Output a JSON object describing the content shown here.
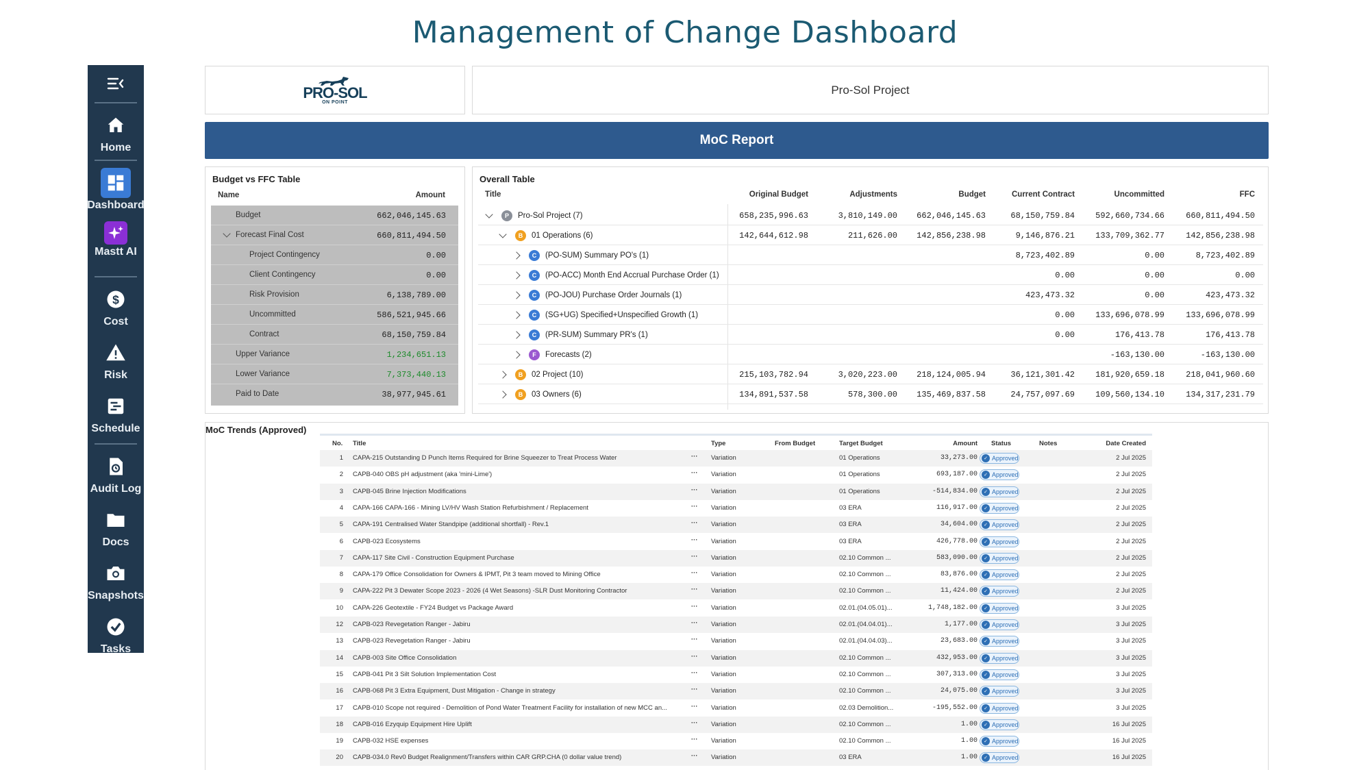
{
  "page": {
    "title": "Management of Change Dashboard"
  },
  "sidebar": {
    "items": [
      {
        "label": "Home",
        "icon": "home-icon"
      },
      {
        "label": "Dashboard",
        "icon": "dashboard-icon",
        "active": true
      },
      {
        "label": "Mastt AI",
        "icon": "sparkle-icon"
      },
      {
        "label": "Cost",
        "icon": "dollar-icon"
      },
      {
        "label": "Risk",
        "icon": "warning-icon"
      },
      {
        "label": "Schedule",
        "icon": "schedule-icon"
      },
      {
        "label": "Audit Log",
        "icon": "history-icon"
      },
      {
        "label": "Docs",
        "icon": "folder-icon"
      },
      {
        "label": "Snapshots",
        "icon": "camera-icon"
      },
      {
        "label": "Tasks",
        "icon": "check-circle-icon"
      }
    ]
  },
  "header": {
    "logo_text": "PRO-SOL",
    "logo_sub": "ON POINT",
    "project_name": "Pro-Sol Project",
    "report_title": "MoC Report"
  },
  "colors": {
    "sidebar": "#21384e",
    "banner": "#2e5a8e",
    "title": "#1b5a72",
    "positive": "#1c8a2a"
  },
  "budget_vs_ffc": {
    "title": "Budget vs FFC Table",
    "col_name": "Name",
    "col_amount": "Amount",
    "rows": [
      {
        "name": "Budget",
        "amount": "662,046,145.63"
      },
      {
        "name": "Forecast Final Cost",
        "amount": "660,811,494.50"
      },
      {
        "name": "Project Contingency",
        "amount": "0.00"
      },
      {
        "name": "Client Contingency",
        "amount": "0.00"
      },
      {
        "name": "Risk Provision",
        "amount": "6,138,789.00"
      },
      {
        "name": "Uncommitted",
        "amount": "586,521,945.66"
      },
      {
        "name": "Contract",
        "amount": "68,150,759.84"
      },
      {
        "name": "Upper Variance",
        "amount": "1,234,651.13"
      },
      {
        "name": "Lower Variance",
        "amount": "7,373,440.13"
      },
      {
        "name": "Paid to Date",
        "amount": "38,977,945.61"
      }
    ]
  },
  "overall": {
    "title": "Overall Table",
    "columns": [
      "Title",
      "Original Budget",
      "Adjustments",
      "Budget",
      "Current Contract",
      "Uncommitted",
      "FFC"
    ],
    "rows": [
      {
        "title": "Pro-Sol Project  (7)",
        "badge": "P",
        "ob": "658,235,996.63",
        "adj": "3,810,149.00",
        "bud": "662,046,145.63",
        "cc": "68,150,759.84",
        "unc": "592,660,734.66",
        "ffc": "660,811,494.50"
      },
      {
        "title": "01 Operations  (6)",
        "badge": "B",
        "ob": "142,644,612.98",
        "adj": "211,626.00",
        "bud": "142,856,238.98",
        "cc": "9,146,876.21",
        "unc": "133,709,362.77",
        "ffc": "142,856,238.98"
      },
      {
        "title": "(PO-SUM) Summary PO's  (1)",
        "badge": "C",
        "ob": "",
        "adj": "",
        "bud": "",
        "cc": "8,723,402.89",
        "unc": "0.00",
        "ffc": "8,723,402.89"
      },
      {
        "title": "(PO-ACC) Month End Accrual Purchase Order  (1)",
        "badge": "C",
        "ob": "",
        "adj": "",
        "bud": "",
        "cc": "0.00",
        "unc": "0.00",
        "ffc": "0.00"
      },
      {
        "title": "(PO-JOU) Purchase Order Journals  (1)",
        "badge": "C",
        "ob": "",
        "adj": "",
        "bud": "",
        "cc": "423,473.32",
        "unc": "0.00",
        "ffc": "423,473.32"
      },
      {
        "title": "(SG+UG) Specified+Unspecified Growth  (1)",
        "badge": "C",
        "ob": "",
        "adj": "",
        "bud": "",
        "cc": "0.00",
        "unc": "133,696,078.99",
        "ffc": "133,696,078.99"
      },
      {
        "title": "(PR-SUM) Summary PR's  (1)",
        "badge": "C",
        "ob": "",
        "adj": "",
        "bud": "",
        "cc": "0.00",
        "unc": "176,413.78",
        "ffc": "176,413.78"
      },
      {
        "title": "Forecasts  (2)",
        "badge": "F",
        "ob": "",
        "adj": "",
        "bud": "",
        "cc": "",
        "unc": "-163,130.00",
        "ffc": "-163,130.00"
      },
      {
        "title": "02 Project  (10)",
        "badge": "B",
        "ob": "215,103,782.94",
        "adj": "3,020,223.00",
        "bud": "218,124,005.94",
        "cc": "36,121,301.42",
        "unc": "181,920,659.18",
        "ffc": "218,041,960.60"
      },
      {
        "title": "03 Owners  (6)",
        "badge": "B",
        "ob": "134,891,537.58",
        "adj": "578,300.00",
        "bud": "135,469,837.58",
        "cc": "24,757,097.69",
        "unc": "109,560,134.10",
        "ffc": "134,317,231.79"
      }
    ]
  },
  "trends": {
    "title": "MoC Trends (Approved)",
    "columns": [
      "No.",
      "Title",
      "Type",
      "From Budget",
      "Target Budget",
      "Amount",
      "Status",
      "Notes",
      "Date Created"
    ],
    "more_label": "···",
    "status_label": "Approved",
    "rows": [
      {
        "no": "1",
        "title": "CAPA-215 Outstanding D Punch Items Required for Brine Squeezer to Treat Process Water",
        "type": "Variation",
        "target": "01 Operations",
        "amount": "33,273.00",
        "date": "2 Jul 2025"
      },
      {
        "no": "2",
        "title": "CAPB-040 OBS pH adjustment (aka 'mini-Lime')",
        "type": "Variation",
        "target": "01 Operations",
        "amount": "693,187.00",
        "date": "2 Jul 2025"
      },
      {
        "no": "3",
        "title": "CAPB-045 Brine Injection Modifications",
        "type": "Variation",
        "target": "01 Operations",
        "amount": "-514,834.00",
        "date": "2 Jul 2025"
      },
      {
        "no": "4",
        "title": "CAPA-166 CAPA-166 - Mining LV/HV Wash Station Refurbishment / Replacement",
        "type": "Variation",
        "target": "03 ERA",
        "amount": "116,917.00",
        "date": "2 Jul 2025"
      },
      {
        "no": "5",
        "title": "CAPA-191 Centralised Water Standpipe (additional shortfall) - Rev.1",
        "type": "Variation",
        "target": "03 ERA",
        "amount": "34,604.00",
        "date": "2 Jul 2025"
      },
      {
        "no": "6",
        "title": "CAPB-023 Ecosystems",
        "type": "Variation",
        "target": "03 ERA",
        "amount": "426,778.00",
        "date": "2 Jul 2025"
      },
      {
        "no": "7",
        "title": "CAPA-117 Site Civil - Construction Equipment Purchase",
        "type": "Variation",
        "target": "02.10 Common ...",
        "amount": "583,090.00",
        "date": "2 Jul 2025"
      },
      {
        "no": "8",
        "title": "CAPA-179 Office Consolidation for Owners & IPMT, Pit 3 team moved to Mining Office",
        "type": "Variation",
        "target": "02.10 Common ...",
        "amount": "83,876.00",
        "date": "2 Jul 2025"
      },
      {
        "no": "9",
        "title": "CAPA-222 Pit 3 Dewater Scope 2023 - 2026 (4 Wet Seasons) -SLR Dust Monitoring Contractor",
        "type": "Variation",
        "target": "02.10 Common ...",
        "amount": "11,424.00",
        "date": "2 Jul 2025"
      },
      {
        "no": "10",
        "title": "CAPA-226 Geotextile - FY24 Budget vs Package Award",
        "type": "Variation",
        "target": "02.01.(04.05.01)...",
        "amount": "1,748,182.00",
        "date": "3 Jul 2025"
      },
      {
        "no": "12",
        "title": "CAPB-023 Revegetation Ranger - Jabiru",
        "type": "Variation",
        "target": "02.01.(04.04.01)...",
        "amount": "1,177.00",
        "date": "3 Jul 2025"
      },
      {
        "no": "13",
        "title": "CAPB-023 Revegetation Ranger - Jabiru",
        "type": "Variation",
        "target": "02.01.(04.04.03)...",
        "amount": "23,683.00",
        "date": "3 Jul 2025"
      },
      {
        "no": "14",
        "title": "CAPB-003 Site Office Consolidation",
        "type": "Variation",
        "target": "02.10 Common ...",
        "amount": "432,953.00",
        "date": "3 Jul 2025"
      },
      {
        "no": "15",
        "title": "CAPB-041 Pit 3 Silt Solution Implementation Cost",
        "type": "Variation",
        "target": "02.10 Common ...",
        "amount": "307,313.00",
        "date": "3 Jul 2025"
      },
      {
        "no": "16",
        "title": "CAPB-068 Pit 3 Extra Equipment, Dust Mitigation - Change in strategy",
        "type": "Variation",
        "target": "02.10 Common ...",
        "amount": "24,075.00",
        "date": "3 Jul 2025"
      },
      {
        "no": "17",
        "title": "CAPB-010 Scope not required - Demolition of Pond Water Treatment Facility for installation of new MCC an...",
        "type": "Variation",
        "target": "02.03 Demolition...",
        "amount": "-195,552.00",
        "date": "3 Jul 2025"
      },
      {
        "no": "18",
        "title": "CAPB-016 Ezyquip Equipment Hire Uplift",
        "type": "Variation",
        "target": "02.10 Common ...",
        "amount": "1.00",
        "date": "16 Jul 2025"
      },
      {
        "no": "19",
        "title": "CAPB-032 HSE expenses",
        "type": "Variation",
        "target": "02.10 Common ...",
        "amount": "1.00",
        "date": "16 Jul 2025"
      },
      {
        "no": "20",
        "title": "CAPB-034.0 Rev0 Budget Realignment/Transfers within CAR GRP.CHA (0 dollar value trend)",
        "type": "Variation",
        "target": "03 ERA",
        "amount": "1.00",
        "date": "16 Jul 2025"
      }
    ]
  }
}
